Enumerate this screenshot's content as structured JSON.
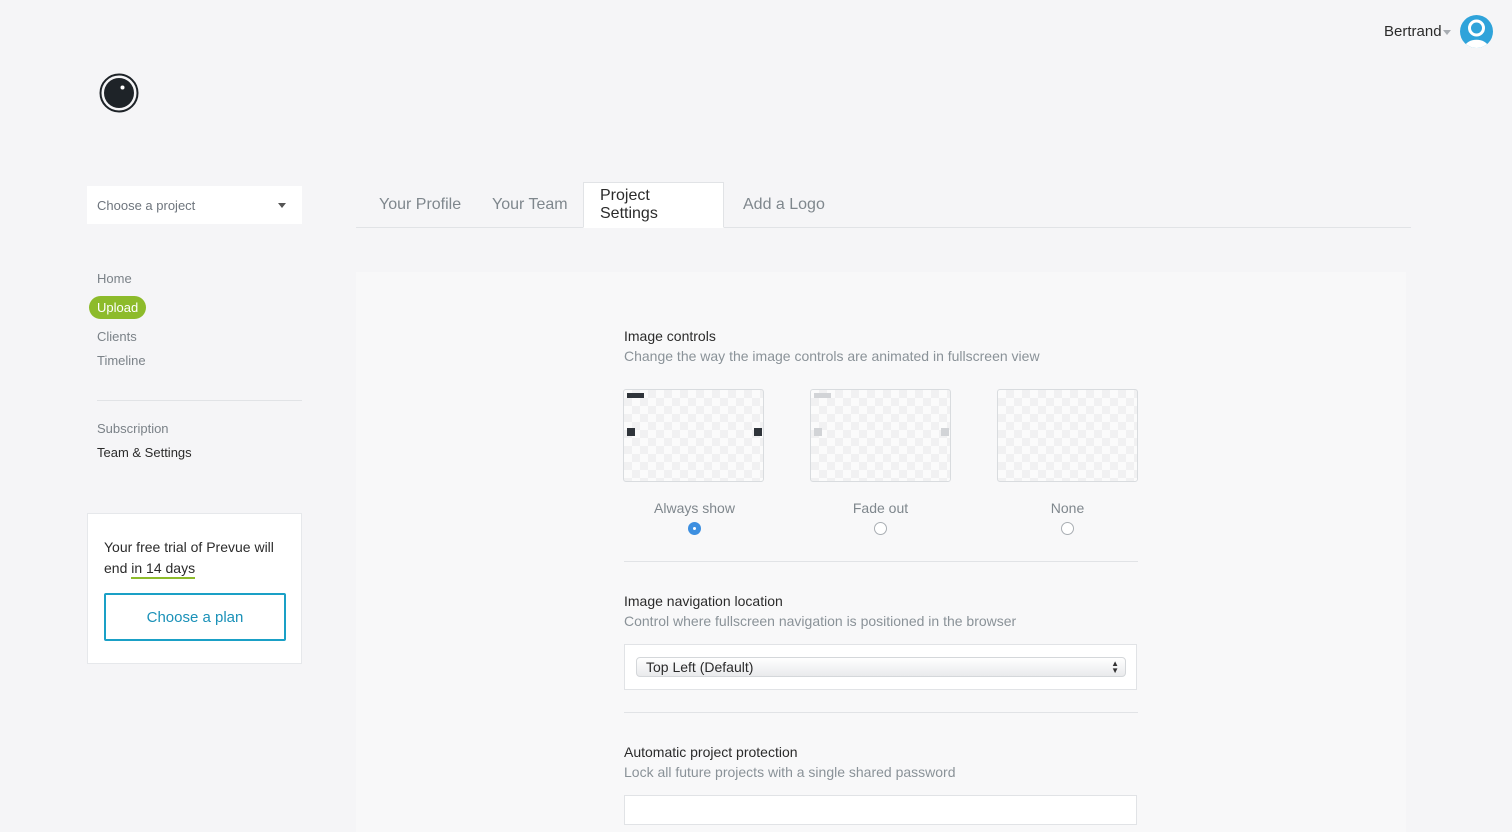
{
  "user": {
    "name": "Bertrand"
  },
  "project_chooser": {
    "placeholder": "Choose a project"
  },
  "nav": {
    "primary": [
      "Home",
      "Upload",
      "Clients",
      "Timeline"
    ],
    "secondary": [
      "Subscription",
      "Team & Settings"
    ]
  },
  "trial": {
    "text_before": "Your free trial of Prevue will end ",
    "days": "in 14 days",
    "button": "Choose a plan"
  },
  "tabs": [
    {
      "label": "Your Profile",
      "active": false
    },
    {
      "label": "Your Team",
      "active": false
    },
    {
      "label": "Project Settings",
      "active": true
    },
    {
      "label": "Add a Logo",
      "active": false
    }
  ],
  "image_controls": {
    "title": "Image controls",
    "description": "Change the way the image controls are animated in fullscreen view",
    "options": [
      {
        "label": "Always show",
        "selected": true
      },
      {
        "label": "Fade out",
        "selected": false
      },
      {
        "label": "None",
        "selected": false
      }
    ]
  },
  "navigation_location": {
    "title": "Image navigation location",
    "description": "Control where fullscreen navigation is positioned in the browser",
    "selected": "Top Left (Default)"
  },
  "protection": {
    "title": "Automatic project protection",
    "description": "Lock all future projects with a single shared password"
  },
  "colors": {
    "accent_green": "#8dbb2b",
    "accent_teal": "#1aa0c6",
    "radio_blue": "#3d8fe0",
    "avatar_blue": "#2fa3da"
  }
}
